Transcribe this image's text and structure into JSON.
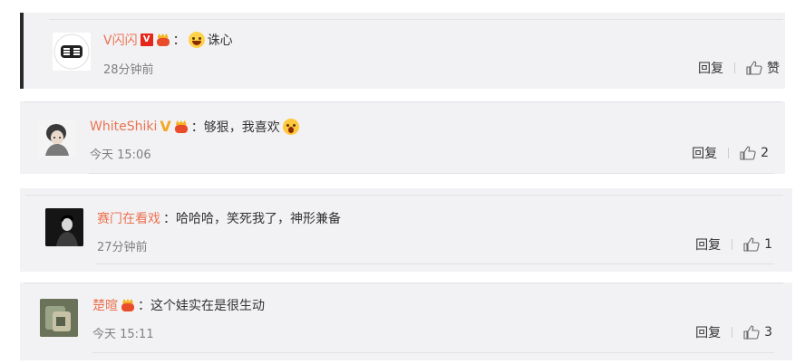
{
  "comments": [
    {
      "username": "V闪闪",
      "badges": [
        "v-red-badge",
        "fan-badge"
      ],
      "text_prefix": "：",
      "emoji_before": "laughing-tears-emoji",
      "text": "诛心",
      "time": "28分钟前",
      "reply_label": "回复",
      "like_label": "赞"
    },
    {
      "username": "WhiteShiki",
      "badges": [
        "v-gold-badge",
        "fan-badge"
      ],
      "text": "：够狠，我喜欢",
      "emoji_after": "screaming-emoji",
      "time": "今天 15:06",
      "reply_label": "回复",
      "like_label": "2"
    },
    {
      "username": "赛门在看戏",
      "badges": [],
      "text": "：哈哈哈，笑死我了，神形兼备",
      "time": "27分钟前",
      "reply_label": "回复",
      "like_label": "1"
    },
    {
      "username": "楚暄",
      "badges": [
        "fan-badge"
      ],
      "text": "：这个娃实在是很生动",
      "time": "今天 15:11",
      "reply_label": "回复",
      "like_label": "3"
    }
  ],
  "colors": {
    "username": "#eb7350",
    "card_bg": "#f2f2f5",
    "time": "#808080",
    "text": "#333333"
  }
}
